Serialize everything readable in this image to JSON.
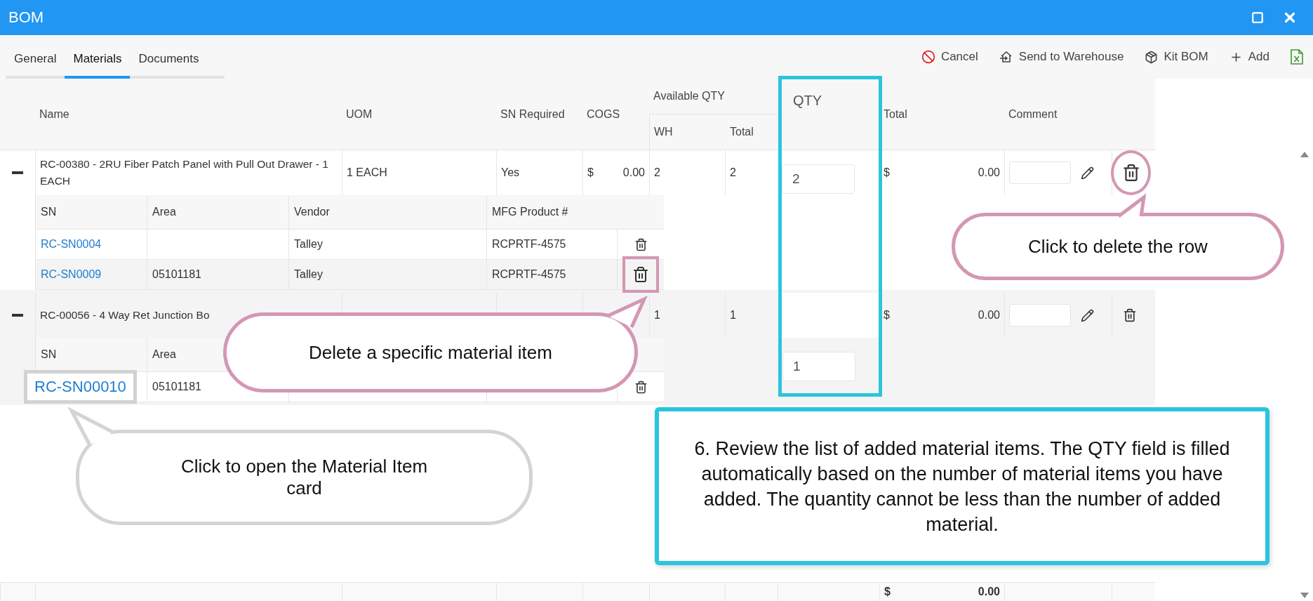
{
  "window": {
    "title": "BOM"
  },
  "tabs": [
    {
      "label": "General",
      "selected": false
    },
    {
      "label": "Materials",
      "selected": true
    },
    {
      "label": "Documents",
      "selected": false
    }
  ],
  "toolbar": [
    {
      "kind": "cancel",
      "label": "Cancel"
    },
    {
      "kind": "send",
      "label": "Send to Warehouse"
    },
    {
      "kind": "kit",
      "label": "Kit BOM"
    },
    {
      "kind": "add",
      "label": "Add"
    },
    {
      "kind": "excel"
    }
  ],
  "columns": {
    "name": "Name",
    "uom": "UOM",
    "sn_required": "SN Required",
    "cogs": "COGS",
    "available_qty": "Available QTY",
    "wh": "WH",
    "available_total": "Total",
    "qty": "QTY",
    "total": "Total",
    "comment": "Comment"
  },
  "groups": [
    {
      "expanded": true,
      "name": "RC-00380 - 2RU Fiber Patch Panel with Pull Out Drawer - 1 EACH",
      "uom": "1 EACH",
      "sn_required": "Yes",
      "cogs_currency": "$",
      "cogs": "0.00",
      "wh": "2",
      "available_total": "2",
      "qty": "2",
      "qty_in_detail": false,
      "total_currency": "$",
      "total": "0.00",
      "delete_highlighted": true,
      "detail_columns": [
        "SN",
        "Area",
        "Vendor",
        "MFG Product #"
      ],
      "items": [
        {
          "sn": "RC-SN0004",
          "vendor": "Talley",
          "mfg": "RCPRTF-4575",
          "sn_highlighted": false,
          "delete_highlighted": false
        },
        {
          "sn": "RC-SN0009",
          "area": "05101181",
          "vendor": "Talley",
          "mfg": "RCPRTF-4575",
          "sn_highlighted": false,
          "delete_highlighted": true
        }
      ]
    },
    {
      "expanded": true,
      "name": "RC-00056 - 4 Way Ret Junction Bo",
      "wh": "1",
      "available_total": "1",
      "qty": "1",
      "qty_in_detail": true,
      "total_currency": "$",
      "total": "0.00",
      "delete_highlighted": false,
      "detail_columns": [
        "SN",
        "Area"
      ],
      "items": [
        {
          "sn": "RC-SN00010",
          "area": "05101181",
          "sn_highlighted": true,
          "delete_highlighted": false
        }
      ]
    }
  ],
  "footer": {
    "currency": "$",
    "total": "0.00"
  },
  "callouts": [
    {
      "kind": "pink",
      "text": "Click to delete the row"
    },
    {
      "kind": "pink",
      "text": "Delete a specific material item"
    },
    {
      "kind": "gray",
      "text": "Click to open the Material Item card"
    },
    {
      "kind": "note",
      "text": "6. Review the list of added material items. The QTY field is filled automatically based on the number of material items you have added. The quantity cannot be less than the number of added material."
    }
  ]
}
